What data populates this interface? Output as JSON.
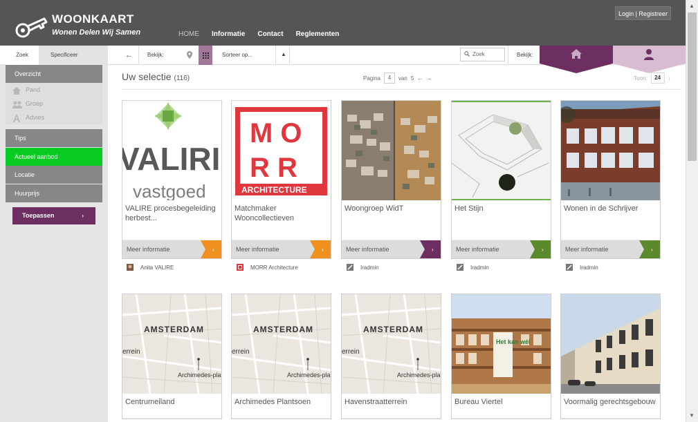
{
  "header": {
    "title": "WOONKAART",
    "tagline": "Wonen Delen Wij Samen",
    "nav": [
      "HOME",
      "Informatie",
      "Contact",
      "Reglementen"
    ],
    "login": "Login | Registreer"
  },
  "toolbar": {
    "tab_zoek": "Zoek",
    "tab_specificeer": "Specificeer",
    "back_arrow": "←",
    "bekijk_label": "Bekijk:",
    "sort_label": "Sorteer op...",
    "search_placeholder": "Zoek",
    "bekijk_label_2": "Bekijk:"
  },
  "sidebar": {
    "overzicht": "Overzicht",
    "sub_items": [
      "Pand",
      "Groep",
      "Advies"
    ],
    "tips": "Tips",
    "actueel": "Actueel aanbod",
    "locatie": "Locatie",
    "huurprijs": "Huurprijs",
    "apply": "Toepassen",
    "apply_arrow": "›"
  },
  "main": {
    "title": "Uw selectie",
    "count": "(116)",
    "pager_label": "Pagina",
    "page": "4",
    "van": "van",
    "total_pages": "5",
    "prev": "←",
    "next": "→",
    "toon_label": "Toon:",
    "toon_value": "24",
    "toon_caret": "↓",
    "more_label": "Meer informatie",
    "more_arrow": "›"
  },
  "cards": [
    {
      "title": "VALIRE procesbegeleiding herbest...",
      "owner": "Anita VALIRE",
      "color": "#f0901e",
      "thumb_text_1": "VALIRI",
      "thumb_text_2": "vastgoed"
    },
    {
      "title": "Matchmaker Wooncollectieven",
      "owner": "MORR Architecture",
      "color": "#f0901e",
      "thumb_text_1": "M O",
      "thumb_text_2": "R R",
      "thumb_text_3": "ARCHITECTURE"
    },
    {
      "title": "Woongroep WidT",
      "owner": "Iradmin",
      "color": "#6d2e62"
    },
    {
      "title": "Het Stijn",
      "owner": "Iradmin",
      "color": "#5a8a2c"
    },
    {
      "title": "Wonen in de Schrijver",
      "owner": "Iradmin",
      "color": "#5a8a2c"
    },
    {
      "title": "Centrumeiland",
      "map_city": "AMSTERDAM",
      "map_place": "Archimedes-plantsoen",
      "map_left": "errein"
    },
    {
      "title": "Archimedes Plantsoen",
      "map_city": "AMSTERDAM",
      "map_place": "Archimedes-plantsoen",
      "map_left": "errein"
    },
    {
      "title": "Havenstraatterrein",
      "map_city": "AMSTERDAM",
      "map_place": "Archimedes-plantsoen",
      "map_left": "errein"
    },
    {
      "title": "Bureau Viertel",
      "banner": "Het kan wél"
    },
    {
      "title": "Voormalig gerechtsgebouw"
    }
  ],
  "colors": {
    "header_bg": "#555557",
    "accent_purple": "#6d2e62",
    "accent_green": "#08cc21",
    "accent_orange": "#f0901e"
  }
}
